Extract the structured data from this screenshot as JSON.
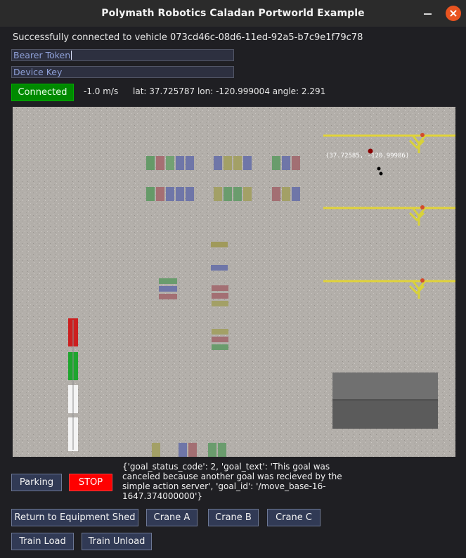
{
  "window": {
    "title": "Polymath Robotics Caladan Portworld Example",
    "minimize_label": "—",
    "close_label": "×"
  },
  "status": {
    "message": "Successfully connected to vehicle 073cd46c-08d6-11ed-92a5-b7c9e1f79c78"
  },
  "fields": {
    "bearer_token": "Bearer Token",
    "device_key": "Device Key"
  },
  "telemetry": {
    "connection_label": "Connected",
    "speed": "-1.0 m/s",
    "position": "lat: 37.725787 lon: -120.999004 angle: 2.291"
  },
  "map": {
    "marker_label": "(37.72585, -120.99986)"
  },
  "controls": {
    "parking": "Parking",
    "stop": "STOP",
    "goal_status": "{'goal_status_code': 2, 'goal_text': 'This goal was canceled because another goal was recieved by the simple action server', 'goal_id': '/move_base-16-1647.374000000'}",
    "return_shed": "Return to Equipment Shed",
    "crane_a": "Crane A",
    "crane_b": "Crane B",
    "crane_c": "Crane C",
    "train_load": "Train Load",
    "train_unload": "Train Unload"
  },
  "colors": {
    "connected": "#008a00",
    "stop": "#ff0000",
    "crane": "#e1d33a",
    "terrain": "#b2aea9"
  }
}
